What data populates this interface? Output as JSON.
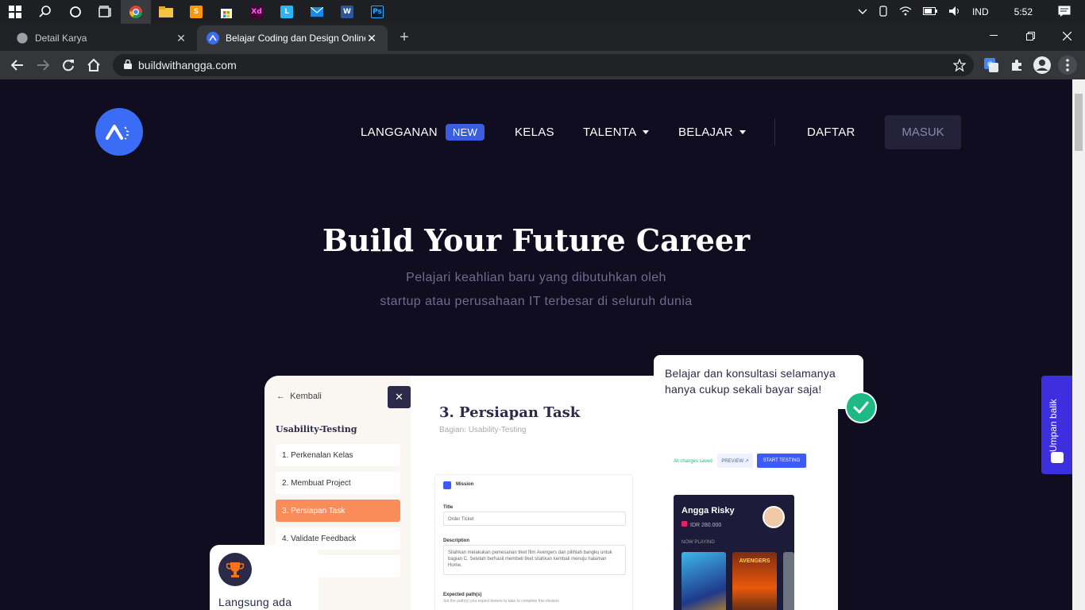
{
  "taskbar": {
    "clock": "5:52",
    "language": "IND"
  },
  "browser": {
    "tabs": [
      {
        "title": "Detail Karya",
        "active": false
      },
      {
        "title": "Belajar Coding dan Design Online",
        "active": true
      }
    ],
    "url": "buildwithangga.com"
  },
  "nav": {
    "langganan": "LANGGANAN",
    "new_badge": "NEW",
    "kelas": "KELAS",
    "talenta": "TALENTA",
    "belajar": "BELAJAR",
    "daftar": "DAFTAR",
    "masuk": "MASUK"
  },
  "hero": {
    "title": "Build Your Future Career",
    "subtitle_line1": "Pelajari keahlian baru yang dibutuhkan oleh",
    "subtitle_line2": "startup atau perusahaan IT terbesar di seluruh dunia"
  },
  "preview": {
    "back": "Kembali",
    "section": "Usability-Testing",
    "lessons": [
      {
        "label": "1. Perkenalan Kelas"
      },
      {
        "label": "2. Membuat Project"
      },
      {
        "label": "3. Persiapan Task"
      },
      {
        "label": "4. Validate Feedback"
      },
      {
        "label": "5. "
      }
    ],
    "title": "3. Persiapan Task",
    "subtitle": "Bagian: Usability-Testing",
    "preview_btn": "PREVIEW ↗",
    "start_btn": "START TESTING",
    "saved": "All changes saved",
    "mission": "Mission",
    "title_label": "Title",
    "title_value": "Order Ticket",
    "desc_label": "Description",
    "desc_value": "Silahkan melakukan pemesanan tiket film Avengers dan pilihlah bangku untuk bagian C. Setelah berhasil membeli tiket silahkan kembali menuju halaman Home.",
    "path_label": "Expected path(s)",
    "path_hint": "Set the path(s) you expect testers to take to complete this mission",
    "movie_name": "Angga Risky",
    "movie_price": "IDR 280.000",
    "now_playing": "NOW PLAYING",
    "poster2": "AVENGERS"
  },
  "tooltip": {
    "line1": "Belajar dan konsultasi selamanya",
    "line2": "hanya cukup sekali bayar saja!"
  },
  "trophy": {
    "text": "Langsung ada"
  },
  "feedback": {
    "label": "Umpan balik"
  }
}
